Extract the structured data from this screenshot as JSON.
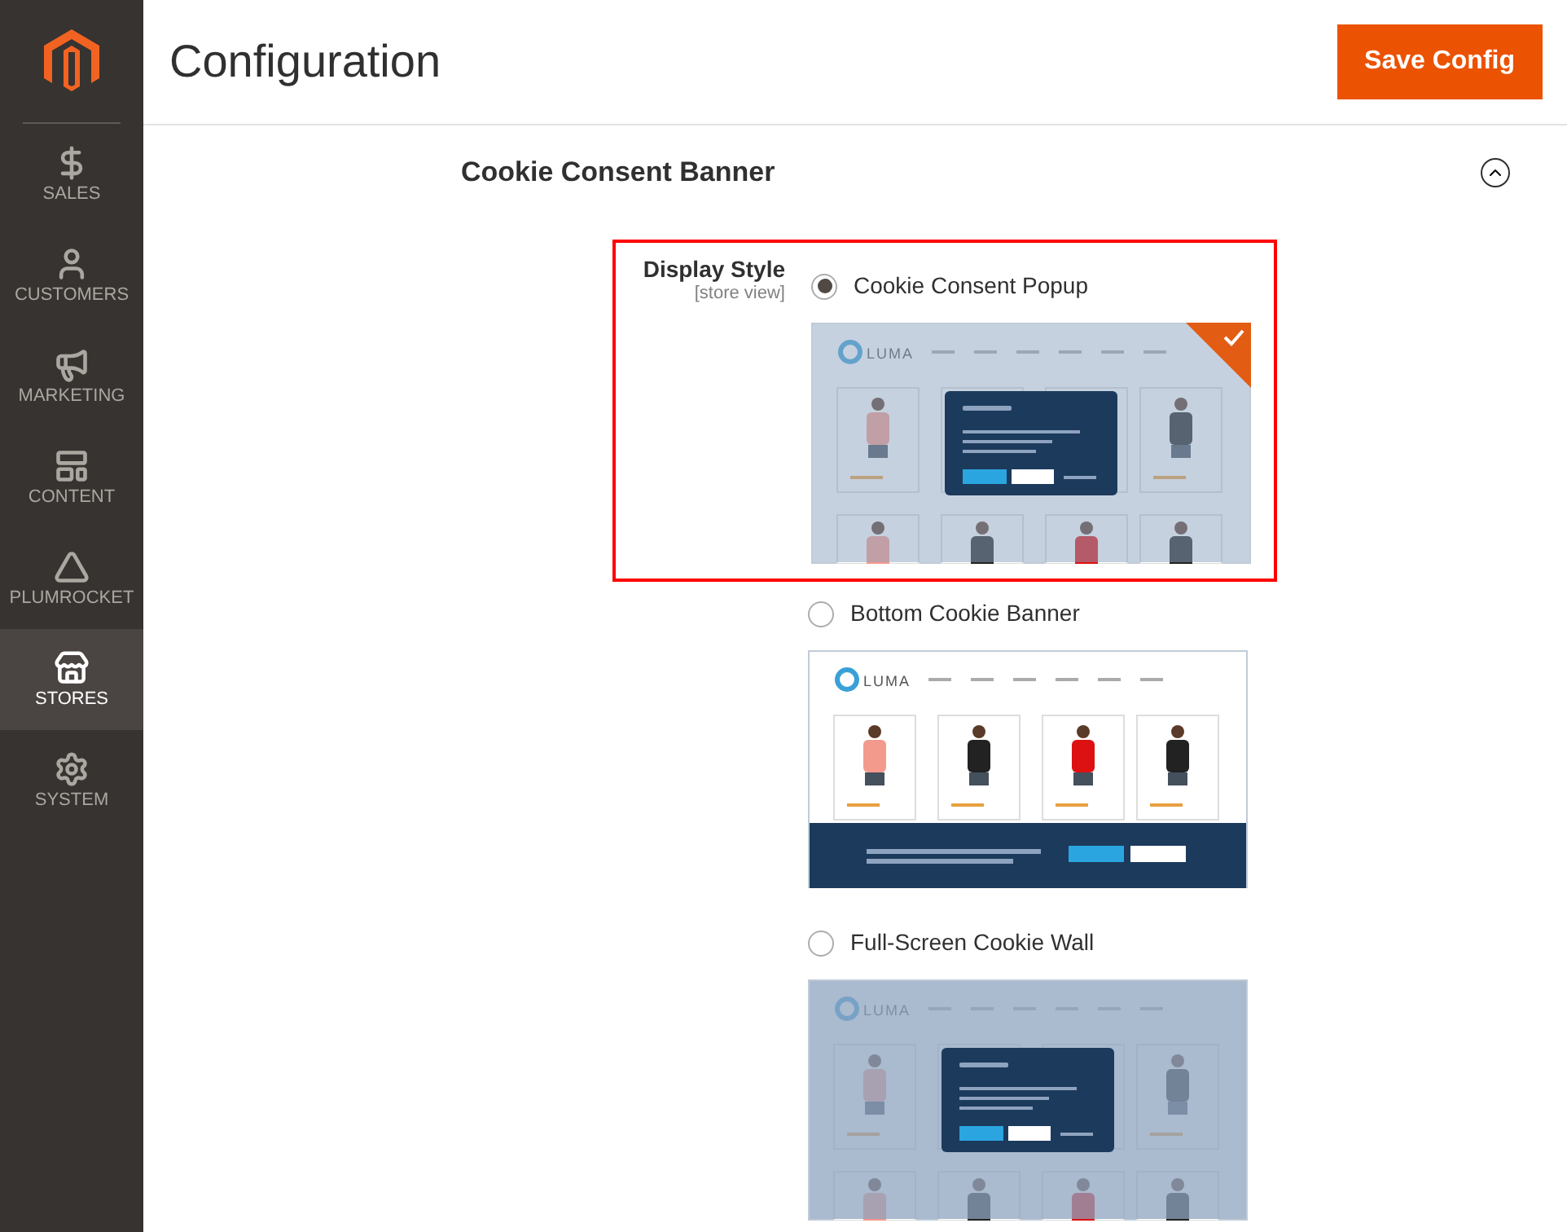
{
  "sidebar": {
    "items": [
      {
        "kind": "sales",
        "label": "SALES",
        "selected": false
      },
      {
        "kind": "customers",
        "label": "CUSTOMERS",
        "selected": false
      },
      {
        "kind": "marketing",
        "label": "MARKETING",
        "selected": false
      },
      {
        "kind": "content",
        "label": "CONTENT",
        "selected": false
      },
      {
        "kind": "plumrocket",
        "label": "PLUMROCKET",
        "selected": false
      },
      {
        "kind": "stores",
        "label": "STORES",
        "selected": true
      },
      {
        "kind": "system",
        "label": "SYSTEM",
        "selected": false
      }
    ]
  },
  "header": {
    "title": "Configuration",
    "save_button": "Save Config"
  },
  "section": {
    "title": "Cookie Consent Banner",
    "expanded": true,
    "field": {
      "label": "Display Style",
      "scope": "[store view]",
      "options": [
        {
          "kind": "popup",
          "label": "Cookie Consent Popup",
          "selected": true,
          "highlighted": true,
          "preview_logo": "LUMA"
        },
        {
          "kind": "bottom",
          "label": "Bottom Cookie Banner",
          "selected": false,
          "highlighted": false,
          "preview_logo": "LUMA"
        },
        {
          "kind": "wall",
          "label": "Full-Screen Cookie Wall",
          "selected": false,
          "highlighted": false,
          "preview_logo": "LUMA"
        }
      ]
    }
  }
}
